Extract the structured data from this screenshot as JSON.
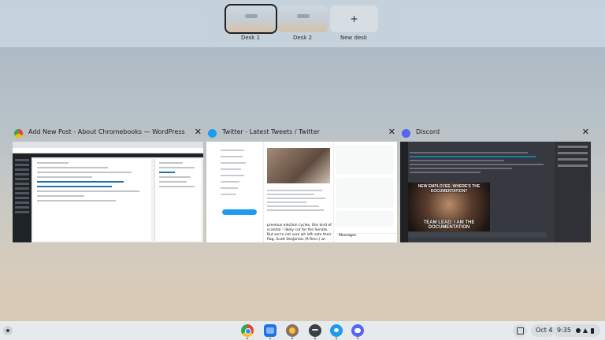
{
  "desks": [
    {
      "label": "Desk 1",
      "active": true
    },
    {
      "label": "Desk 2",
      "active": false
    }
  ],
  "new_desk": {
    "icon": "plus-icon",
    "glyph": "+",
    "label": "New desk"
  },
  "windows": [
    {
      "title": "Add New Post - About Chromebooks — WordPress",
      "icon": "chrome-icon",
      "close": "✕"
    },
    {
      "title": "Twitter - Latest Tweets / Twitter",
      "icon": "twitter-icon",
      "close": "✕",
      "feed_text": "previous election cycles, this kind of scandal – likely cut for the Senate. But we're not sure wh left note their flag. Scott DesJarlais (R-Tenn.) wi",
      "messages_label": "Messages"
    },
    {
      "title": "Discord",
      "icon": "discord-icon",
      "close": "✕",
      "meme_top": "NEW EMPLOYEE: WHERE'S THE DOCUMENTATION?",
      "meme_bottom": "TEAM LEAD: I AM THE DOCUMENTATION"
    }
  ],
  "shelf": {
    "apps": [
      {
        "name": "chrome-app",
        "color": "#ffffff"
      },
      {
        "name": "files-app",
        "color": "#1a73e8"
      },
      {
        "name": "gimp-app",
        "color": "#8d6e63"
      },
      {
        "name": "terminal-app",
        "color": "#3c4043"
      },
      {
        "name": "twitter-app",
        "color": "#1d9bf0"
      },
      {
        "name": "discord-app",
        "color": "#5865f2"
      }
    ],
    "date": "Oct 4",
    "time": "9:35"
  }
}
